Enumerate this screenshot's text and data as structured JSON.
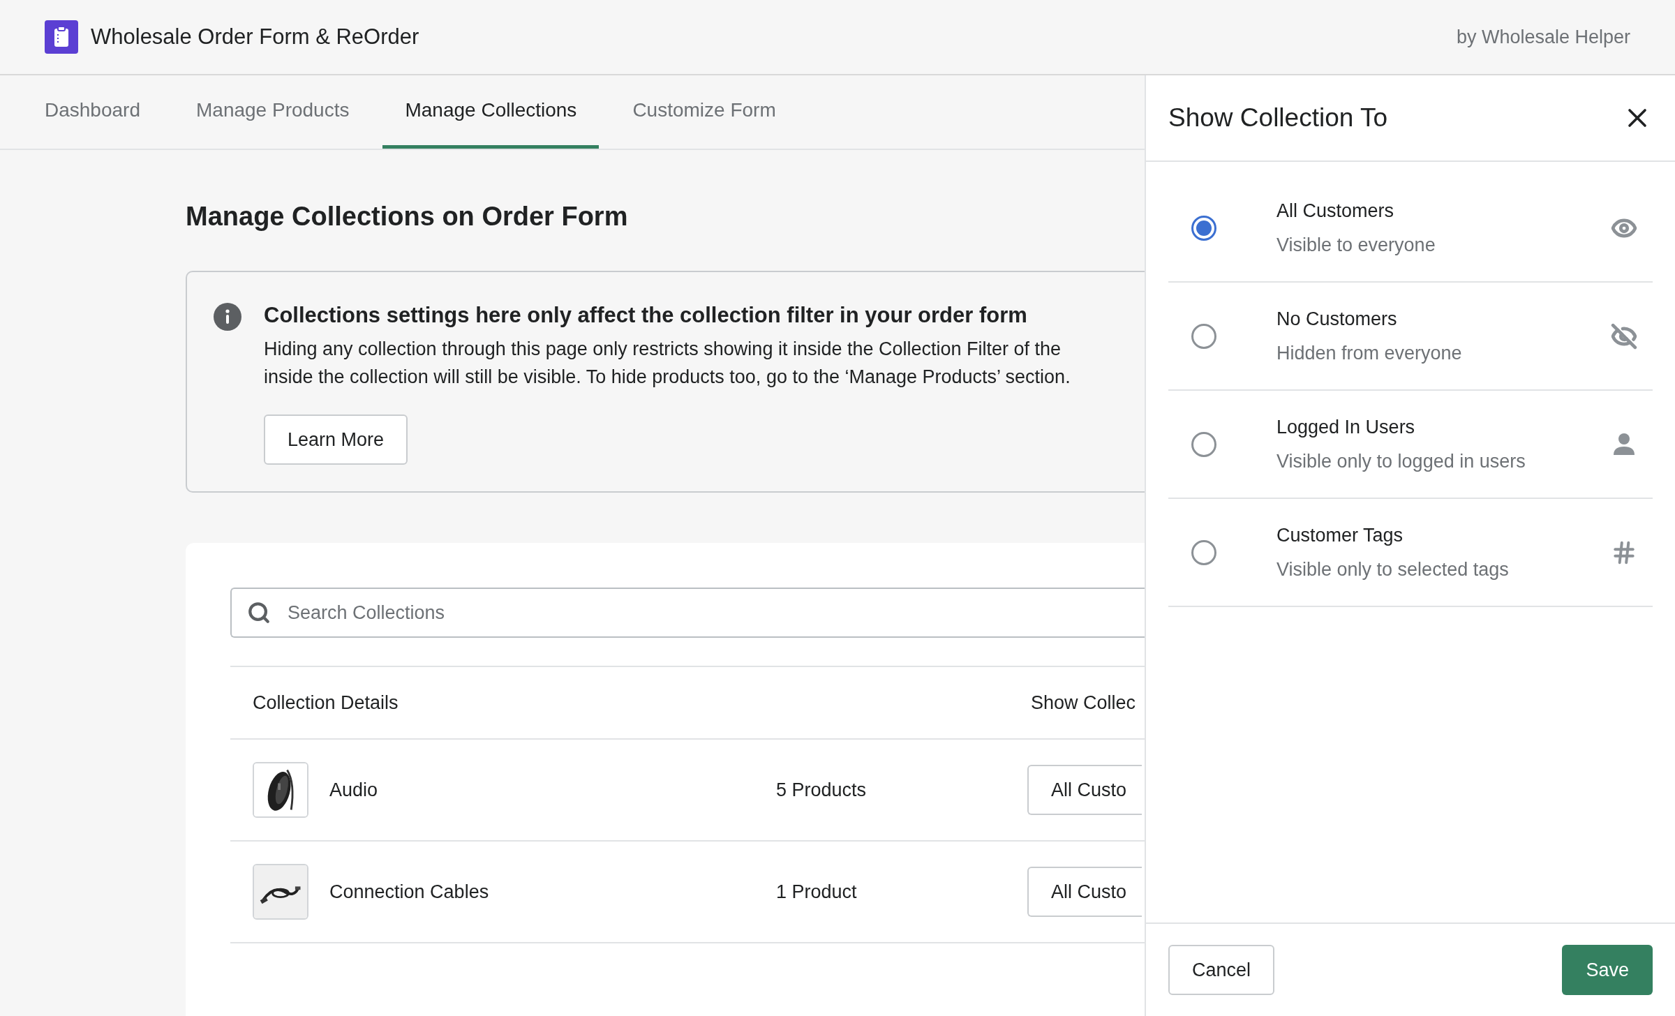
{
  "app": {
    "title": "Wholesale Order Form & ReOrder",
    "byline": "by Wholesale Helper"
  },
  "tabs": [
    {
      "label": "Dashboard",
      "selected": false
    },
    {
      "label": "Manage Products",
      "selected": false
    },
    {
      "label": "Manage Collections",
      "selected": true
    },
    {
      "label": "Customize Form",
      "selected": false
    }
  ],
  "page": {
    "heading": "Manage Collections on Order Form"
  },
  "notice": {
    "title": "Collections settings here only affect the collection filter in your order form",
    "body_lines": [
      "Hiding any collection through this page only restricts showing it inside the Collection Filter of the",
      "inside the collection will still be visible. To hide products too, go to the ‘Manage Products’ section."
    ],
    "button": "Learn More"
  },
  "search": {
    "placeholder": "Search Collections"
  },
  "table": {
    "columns": [
      "Collection Details",
      "Show Collec"
    ],
    "rows": [
      {
        "name": "Audio",
        "products": "5 Products",
        "visibility": "All Custo"
      },
      {
        "name": "Connection Cables",
        "products": "1 Product",
        "visibility": "All Custo"
      }
    ]
  },
  "drawer": {
    "title": "Show Collection To",
    "options": [
      {
        "kind": "eye",
        "label": "All Customers",
        "description": "Visible to everyone",
        "selected": true
      },
      {
        "kind": "eye-off",
        "label": "No Customers",
        "description": "Hidden from everyone",
        "selected": false
      },
      {
        "kind": "user",
        "label": "Logged In Users",
        "description": "Visible only to logged in users",
        "selected": false
      },
      {
        "kind": "hash",
        "label": "Customer Tags",
        "description": "Visible only to selected tags",
        "selected": false
      }
    ],
    "cancel": "Cancel",
    "save": "Save"
  }
}
